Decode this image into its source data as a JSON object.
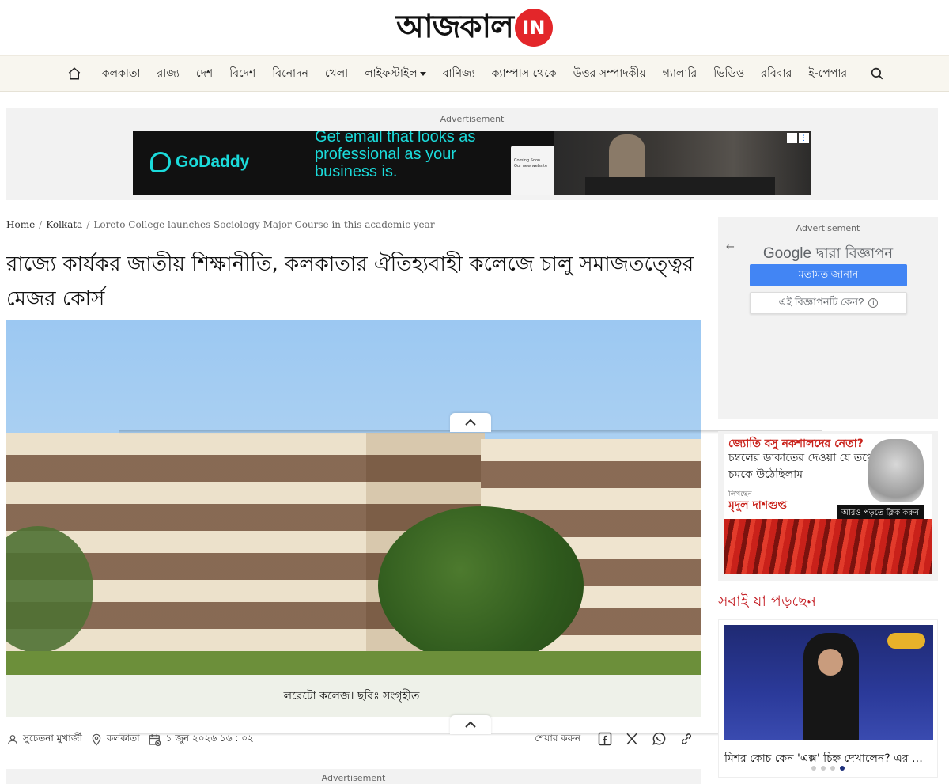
{
  "brand": {
    "logo_text": "আজকাল",
    "logo_badge": "IN",
    "accent": "#e3262a"
  },
  "nav": {
    "items": [
      {
        "label": "কলকাতা"
      },
      {
        "label": "রাজ্য"
      },
      {
        "label": "দেশ"
      },
      {
        "label": "বিদেশ"
      },
      {
        "label": "বিনোদন"
      },
      {
        "label": "খেলা"
      },
      {
        "label": "লাইফস্টাইল",
        "has_dropdown": true
      },
      {
        "label": "বাণিজ্য"
      },
      {
        "label": "ক্যাম্পাস থেকে"
      },
      {
        "label": "উত্তর সম্পাদকীয়"
      },
      {
        "label": "গ্যালারি"
      },
      {
        "label": "ভিডিও"
      },
      {
        "label": "রবিবার"
      },
      {
        "label": "ই-পেপার"
      }
    ],
    "home_icon": "home-icon",
    "search_icon": "search-icon"
  },
  "top_ad": {
    "label": "Advertisement",
    "brand": "GoDaddy",
    "copy": "Get email that looks as professional as your business is.",
    "phone_lines": [
      "Coming Soon",
      "Our new website"
    ]
  },
  "breadcrumb": {
    "home": "Home",
    "section": "Kolkata",
    "current": "Loreto College launches Sociology Major Course in this academic year"
  },
  "article": {
    "headline": "রাজ্যে কার্যকর জাতীয় শিক্ষানীতি, কলকাতার ঐতিহ্যবাহী কলেজে চালু সমাজতত্ত্বের মেজর কোর্স",
    "caption": "লরেটো কলেজ। ছবিঃ সংগৃহীত।",
    "author": "সুচেতনা মুখার্জী",
    "location": "কলকাতা",
    "date": "১ জুন ২০২৬ ১৬ : ০২",
    "share_label": "শেয়ার করুন"
  },
  "bottom_ad": {
    "label": "Advertisement"
  },
  "side_ad": {
    "label": "Advertisement",
    "google": "Google",
    "by_text": "দ্বারা বিজ্ঞাপন",
    "feedback_button": "মতামত জানান",
    "why_button": "এই বিজ্ঞাপনটি কেন?"
  },
  "promo": {
    "line1": "জ্যোতি বসু নকশালদের নেতা?",
    "line2": "চম্বলের ডাকাতের দেওয়া যে তথ্যে চমকে উঠেছিলাম",
    "byline_label": "লিখছেন",
    "author": "মৃদুল দাশগুপ্ত",
    "cta": "আরও পড়তে ক্লিক করুন"
  },
  "trending": {
    "title": "সবাই যা পড়ছেন",
    "card_title": "মিশর কোচ কেন 'এক্স' চিহ্ন দেখালেন? এর …",
    "dots": 4,
    "active_dot": 3
  }
}
